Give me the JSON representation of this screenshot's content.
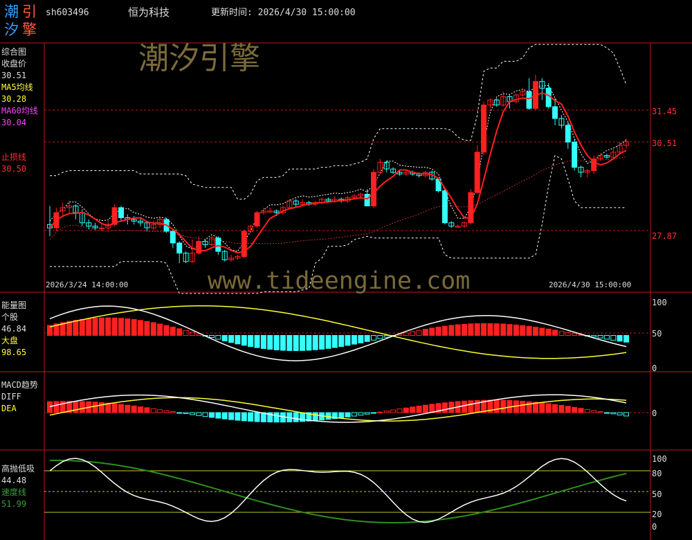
{
  "colors": {
    "up": "#ff2020",
    "down": "#33ffff",
    "grid": "#c01818",
    "white": "#ffffff",
    "yellow": "#ffff33",
    "green": "#2f8f1f",
    "label_red": "#ff3030",
    "label_yellow": "#ffff33",
    "label_pink": "#ff40ff",
    "label_white": "#dddddd"
  },
  "logo": {
    "c1": "潮",
    "c2": "引",
    "c3": "汐",
    "c4": "擎"
  },
  "header": {
    "code": "sh603496",
    "name": "恒为科技",
    "update_label": "更新时间: 2026/4/30 15:00:00"
  },
  "watermarks": {
    "brand": "潮汐引擎",
    "url": "www.tideengine.com"
  },
  "main_panel": {
    "title": "综合图",
    "close_label": "收盘价",
    "close_value": "30.51",
    "ma5_label": "MA5均线",
    "ma5_value": "30.28",
    "ma60_label": "MA60均线",
    "ma60_value": "30.04",
    "stop_label": "止损线",
    "stop_value": "30.50",
    "axis_labels": [
      "31.45",
      "30.51",
      "27.87"
    ],
    "start_time": "2026/3/24 14:00:00",
    "end_time": "2026/4/30 15:00:00"
  },
  "energy_panel": {
    "title": "能量图",
    "stock_label": "个股",
    "stock_value": "46.84",
    "market_label": "大盘",
    "market_value": "98.65",
    "axis_labels": [
      "100",
      "50",
      "0"
    ]
  },
  "macd_panel": {
    "title": "MACD趋势",
    "diff_label": "DIFF",
    "dea_label": "DEA",
    "axis_labels": [
      "0"
    ]
  },
  "high_low_panel": {
    "title": "高抛低吸",
    "value": "44.48",
    "speed_label": "速度线",
    "speed_value": "51.99",
    "axis_labels": [
      "100",
      "80",
      "50",
      "20",
      "0"
    ]
  },
  "chart_data": {
    "type": "candlestick",
    "x_range": [
      "2026/3/24 14:00:00",
      "2026/4/30 15:00:00"
    ],
    "price_axis_ticks": [
      31.45,
      30.51,
      27.87
    ],
    "candles": [
      [
        28.05,
        27.95,
        28.6,
        27.7
      ],
      [
        27.95,
        28.4,
        28.55,
        27.85
      ],
      [
        28.45,
        28.55,
        28.7,
        28.3
      ],
      [
        28.55,
        28.6,
        28.75,
        28.4
      ],
      [
        28.6,
        28.4,
        28.65,
        28.2
      ],
      [
        28.4,
        28.1,
        28.5,
        28.0
      ],
      [
        28.1,
        28.0,
        28.2,
        27.9
      ],
      [
        28.0,
        27.95,
        28.1,
        27.9
      ],
      [
        27.95,
        27.95,
        28.05,
        27.85
      ],
      [
        27.95,
        28.05,
        28.15,
        27.9
      ],
      [
        28.05,
        28.55,
        28.65,
        28.0
      ],
      [
        28.55,
        28.25,
        28.6,
        28.15
      ],
      [
        28.25,
        28.2,
        28.35,
        28.05
      ],
      [
        28.2,
        28.15,
        28.3,
        28.05
      ],
      [
        28.15,
        28.1,
        28.25,
        28.0
      ],
      [
        28.1,
        27.95,
        28.15,
        27.85
      ],
      [
        27.95,
        28.05,
        28.15,
        27.9
      ],
      [
        28.05,
        28.2,
        28.25,
        27.95
      ],
      [
        28.2,
        27.85,
        28.25,
        27.8
      ],
      [
        27.85,
        27.5,
        27.9,
        27.35
      ],
      [
        27.5,
        27.2,
        27.55,
        26.9
      ],
      [
        27.2,
        26.95,
        27.25,
        26.9
      ],
      [
        26.95,
        27.2,
        27.6,
        26.9
      ],
      [
        27.2,
        27.55,
        27.7,
        27.15
      ],
      [
        27.55,
        27.45,
        27.6,
        27.35
      ],
      [
        27.45,
        27.65,
        27.75,
        27.4
      ],
      [
        27.65,
        27.25,
        27.7,
        27.15
      ],
      [
        27.25,
        27.0,
        27.3,
        26.95
      ],
      [
        27.0,
        27.05,
        27.15,
        26.95
      ],
      [
        27.05,
        27.1,
        27.15,
        27.0
      ],
      [
        27.1,
        27.85,
        27.9,
        27.05
      ],
      [
        27.85,
        28.0,
        28.05,
        27.8
      ],
      [
        28.0,
        28.4,
        28.45,
        27.95
      ],
      [
        28.4,
        28.45,
        28.55,
        28.35
      ],
      [
        28.45,
        28.45,
        28.55,
        28.4
      ],
      [
        28.45,
        28.4,
        28.5,
        28.3
      ],
      [
        28.4,
        28.55,
        28.6,
        28.35
      ],
      [
        28.55,
        28.75,
        28.8,
        28.5
      ],
      [
        28.75,
        28.65,
        28.8,
        28.55
      ],
      [
        28.65,
        28.7,
        28.8,
        28.6
      ],
      [
        28.7,
        28.65,
        28.75,
        28.6
      ],
      [
        28.65,
        28.7,
        28.75,
        28.6
      ],
      [
        28.7,
        28.8,
        28.85,
        28.65
      ],
      [
        28.8,
        28.75,
        28.85,
        28.7
      ],
      [
        28.75,
        28.8,
        28.9,
        28.7
      ],
      [
        28.8,
        28.75,
        28.85,
        28.7
      ],
      [
        28.75,
        28.85,
        28.9,
        28.7
      ],
      [
        28.85,
        28.9,
        28.95,
        28.8
      ],
      [
        28.9,
        28.95,
        29.0,
        28.8
      ],
      [
        28.95,
        28.6,
        29.1,
        28.6
      ],
      [
        28.6,
        29.6,
        29.7,
        28.55
      ],
      [
        29.6,
        29.9,
        30.0,
        29.55
      ],
      [
        29.9,
        29.7,
        29.95,
        29.6
      ],
      [
        29.7,
        29.6,
        29.75,
        29.55
      ],
      [
        29.6,
        29.55,
        29.65,
        29.5
      ],
      [
        29.55,
        29.6,
        29.65,
        29.5
      ],
      [
        29.6,
        29.55,
        29.65,
        29.5
      ],
      [
        29.55,
        29.5,
        29.6,
        29.45
      ],
      [
        29.5,
        29.6,
        29.65,
        29.45
      ],
      [
        29.6,
        29.4,
        29.65,
        29.35
      ],
      [
        29.4,
        29.05,
        29.45,
        29.0
      ],
      [
        29.05,
        28.1,
        29.1,
        28.05
      ],
      [
        28.1,
        28.0,
        28.15,
        27.95
      ],
      [
        28.0,
        28.0,
        28.05,
        27.95
      ],
      [
        28.0,
        28.1,
        28.15,
        27.95
      ],
      [
        28.1,
        29.0,
        29.1,
        28.05
      ],
      [
        29.0,
        30.2,
        30.4,
        28.95
      ],
      [
        30.2,
        31.6,
        31.7,
        30.1
      ],
      [
        31.6,
        31.75,
        31.8,
        31.5
      ],
      [
        31.75,
        31.6,
        31.8,
        31.55
      ],
      [
        31.6,
        31.85,
        32.0,
        31.55
      ],
      [
        31.85,
        31.7,
        31.9,
        31.5
      ],
      [
        31.7,
        31.9,
        31.95,
        31.65
      ],
      [
        31.9,
        32.0,
        32.1,
        31.85
      ],
      [
        32.0,
        31.5,
        32.4,
        31.45
      ],
      [
        31.5,
        32.3,
        32.5,
        31.45
      ],
      [
        32.3,
        32.1,
        32.4,
        31.75
      ],
      [
        32.1,
        31.55,
        32.25,
        31.5
      ],
      [
        31.55,
        31.2,
        31.8,
        31.0
      ],
      [
        31.2,
        31.0,
        31.3,
        30.9
      ],
      [
        31.0,
        30.5,
        31.1,
        30.3
      ],
      [
        30.5,
        29.75,
        30.6,
        29.65
      ],
      [
        29.75,
        29.6,
        29.8,
        29.45
      ],
      [
        29.6,
        29.65,
        29.7,
        29.45
      ],
      [
        29.65,
        30.0,
        30.1,
        29.55
      ],
      [
        30.0,
        30.1,
        30.15,
        29.95
      ],
      [
        30.1,
        30.05,
        30.15,
        30.0
      ],
      [
        30.05,
        30.2,
        30.3,
        30.0
      ],
      [
        30.2,
        30.4,
        30.5,
        30.15
      ],
      [
        30.4,
        30.51,
        30.6,
        30.3
      ]
    ]
  }
}
